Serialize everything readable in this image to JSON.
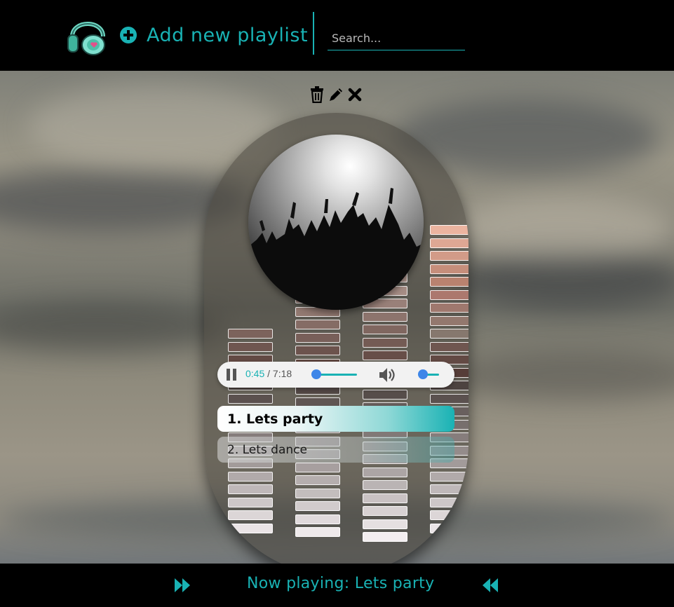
{
  "header": {
    "add_playlist_label": "Add new playlist",
    "search_placeholder": "Search..."
  },
  "icons": {
    "logo": "headphones-logo-icon",
    "add": "plus-circle-icon",
    "delete": "trash-icon",
    "edit": "pencil-icon",
    "close": "close-icon",
    "pause": "pause-icon",
    "volume": "volume-icon",
    "next": "fast-forward-icon",
    "previous": "rewind-icon"
  },
  "player": {
    "current_time": "0:45",
    "separator": " / ",
    "duration": "7:18",
    "progress_fraction": 0.1,
    "volume_fraction": 0.15
  },
  "tracks": [
    {
      "label": "1. Lets party",
      "active": true
    },
    {
      "label": "2. Lets dance",
      "active": false
    }
  ],
  "footer": {
    "now_playing": "Now playing: Lets party"
  },
  "colors": {
    "accent": "#19b2b4",
    "thumb": "#3e86e8",
    "header_bg": "#000000"
  }
}
